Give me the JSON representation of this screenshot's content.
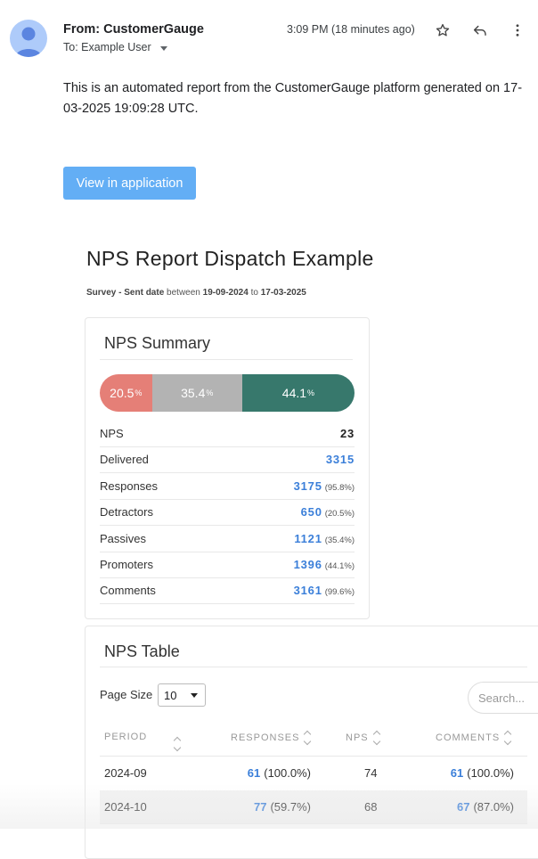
{
  "header": {
    "from": "From: CustomerGauge",
    "to": "To: Example User",
    "time": "3:09 PM (18 minutes ago)",
    "icons": [
      "avatar-icon",
      "star-icon",
      "reply-icon",
      "more-vert-icon"
    ]
  },
  "body": {
    "intro": "This is an automated report from the CustomerGauge platform generated on 17-03-2025 19:09:28 UTC.",
    "view_button": "View in application"
  },
  "report": {
    "title": "NPS Report Dispatch Example",
    "sub_prefix": "Survey - Sent date",
    "sub_between": "between",
    "sub_from": "19-09-2024",
    "sub_to_word": "to",
    "sub_to": "17-03-2025"
  },
  "summary": {
    "title": "NPS Summary",
    "bar": [
      {
        "value": "20.5",
        "unit": "%",
        "fraction": 0.205,
        "color": "#e57f77"
      },
      {
        "value": "35.4",
        "unit": "%",
        "fraction": 0.354,
        "color": "#b3b3b3"
      },
      {
        "value": "44.1",
        "unit": "%",
        "fraction": 0.441,
        "color": "#37786c"
      }
    ],
    "rows": [
      {
        "label": "NPS",
        "value": "23",
        "sub": ""
      },
      {
        "label": "Delivered",
        "value": "3315",
        "sub": ""
      },
      {
        "label": "Responses",
        "value": "3175",
        "sub": "(95.8%)"
      },
      {
        "label": "Detractors",
        "value": "650",
        "sub": "(20.5%)"
      },
      {
        "label": "Passives",
        "value": "1121",
        "sub": "(35.4%)"
      },
      {
        "label": "Promoters",
        "value": "1396",
        "sub": "(44.1%)"
      },
      {
        "label": "Comments",
        "value": "3161",
        "sub": "(99.6%)"
      }
    ]
  },
  "table": {
    "title": "NPS Table",
    "page_size_label": "Page Size",
    "page_size": "10",
    "search_placeholder": "Search...",
    "columns": [
      "PERIOD",
      "RESPONSES",
      "NPS",
      "COMMENTS"
    ],
    "rows": [
      {
        "period": "2024-09",
        "responses": "61",
        "responses_pct": "(100.0%)",
        "nps": "74",
        "comments": "61",
        "comments_pct": "(100.0%)"
      },
      {
        "period": "2024-10",
        "responses": "77",
        "responses_pct": "(59.7%)",
        "nps": "68",
        "comments": "67",
        "comments_pct": "(87.0%)"
      }
    ]
  }
}
